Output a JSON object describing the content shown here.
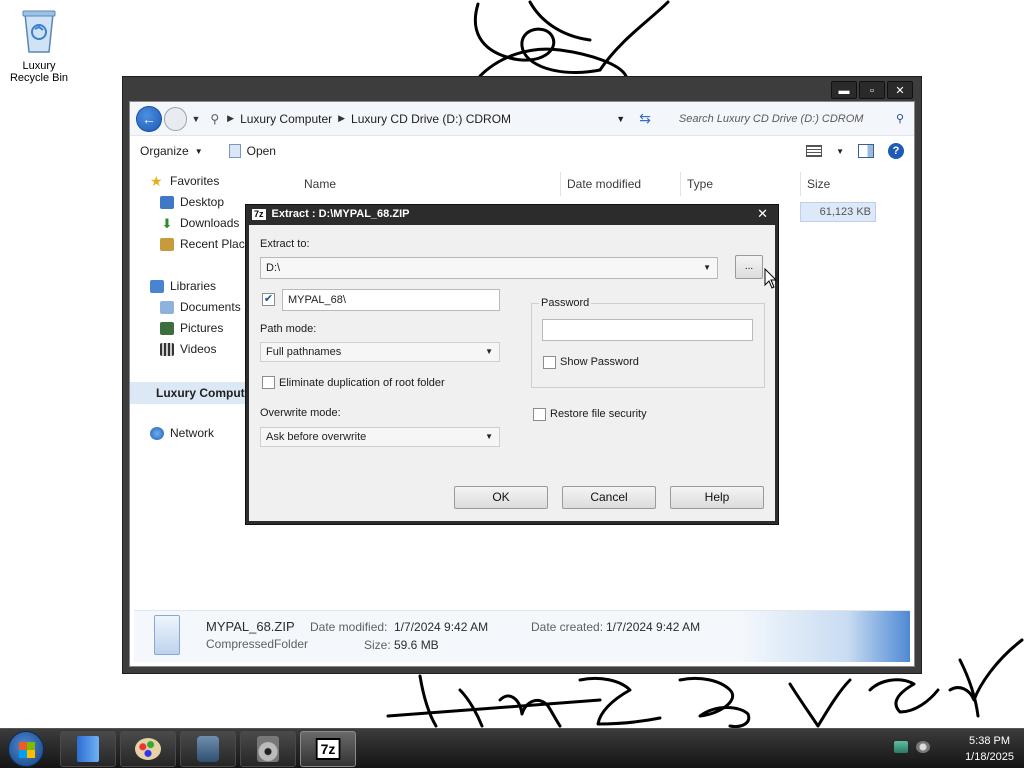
{
  "desktop": {
    "recycle_bin_label": "Luxury Recycle Bin"
  },
  "explorer": {
    "window_buttons": {
      "minimize": "▬",
      "maximize": "▫",
      "close": "✕"
    },
    "breadcrumb": [
      "Luxury Computer",
      "Luxury CD Drive (D:) CDROM"
    ],
    "search_placeholder": "Search Luxury CD Drive (D:) CDROM",
    "toolbar": {
      "organize": "Organize",
      "open": "Open"
    },
    "nav": {
      "favorites": "Favorites",
      "desktop": "Desktop",
      "downloads": "Downloads",
      "recent": "Recent Places",
      "libraries": "Libraries",
      "documents": "Documents",
      "pictures": "Pictures",
      "videos": "Videos",
      "computer": "Luxury Computer",
      "network": "Network"
    },
    "columns": {
      "name": "Name",
      "date_modified": "Date modified",
      "type": "Type",
      "size": "Size"
    },
    "file_row": {
      "size": "61,123 KB"
    },
    "details": {
      "file_name": "MYPAL_68.ZIP",
      "file_type": "CompressedFolder",
      "date_modified_label": "Date modified:",
      "date_modified": "1/7/2024 9:42 AM",
      "date_created_label": "Date created:",
      "date_created": "1/7/2024 9:42 AM",
      "size_label": "Size:",
      "size": "59.6 MB"
    }
  },
  "dialog": {
    "title_logo": "7z",
    "title": "Extract : D:\\MYPAL_68.ZIP",
    "close": "✕",
    "extract_to_label": "Extract to:",
    "extract_to_value": "D:\\",
    "browse": "...",
    "folder_name": "MYPAL_68\\",
    "path_mode_label": "Path mode:",
    "path_mode_value": "Full pathnames",
    "eliminate_dup": "Eliminate duplication of root folder",
    "overwrite_mode_label": "Overwrite mode:",
    "overwrite_mode_value": "Ask before overwrite",
    "password_group": "Password",
    "password_value": "",
    "show_password": "Show Password",
    "restore_security": "Restore file security",
    "ok": "OK",
    "cancel": "Cancel",
    "help": "Help"
  },
  "taskbar": {
    "zip_app_label": "7z",
    "time": "5:38 PM",
    "date": "1/18/2025"
  }
}
